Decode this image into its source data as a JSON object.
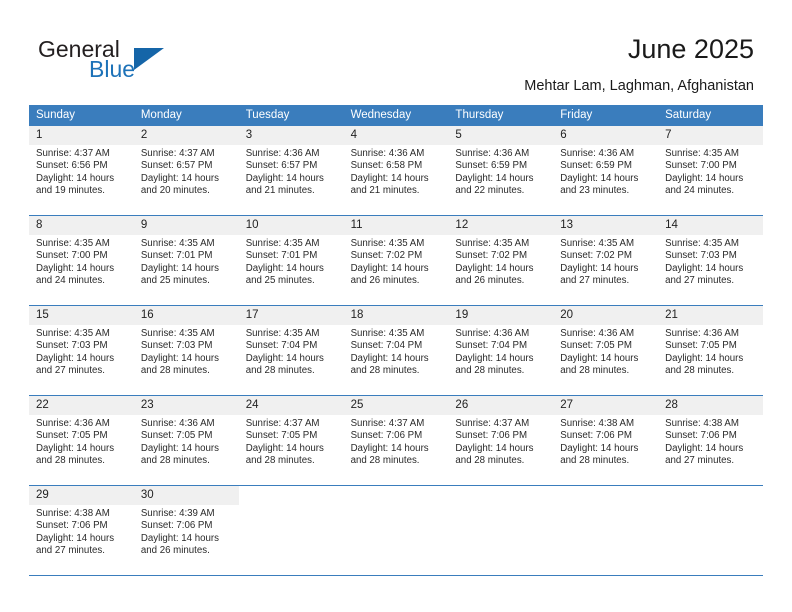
{
  "brand": {
    "name_part1": "General",
    "name_part2": "Blue",
    "accent_color": "#1d72b8"
  },
  "header": {
    "title": "June 2025",
    "subtitle": "Mehtar Lam, Laghman, Afghanistan"
  },
  "calendar": {
    "header_color": "#3a7dbd",
    "weekdays": [
      "Sunday",
      "Monday",
      "Tuesday",
      "Wednesday",
      "Thursday",
      "Friday",
      "Saturday"
    ],
    "weeks": [
      [
        {
          "day": "1",
          "sunrise": "Sunrise: 4:37 AM",
          "sunset": "Sunset: 6:56 PM",
          "daylight1": "Daylight: 14 hours",
          "daylight2": "and 19 minutes."
        },
        {
          "day": "2",
          "sunrise": "Sunrise: 4:37 AM",
          "sunset": "Sunset: 6:57 PM",
          "daylight1": "Daylight: 14 hours",
          "daylight2": "and 20 minutes."
        },
        {
          "day": "3",
          "sunrise": "Sunrise: 4:36 AM",
          "sunset": "Sunset: 6:57 PM",
          "daylight1": "Daylight: 14 hours",
          "daylight2": "and 21 minutes."
        },
        {
          "day": "4",
          "sunrise": "Sunrise: 4:36 AM",
          "sunset": "Sunset: 6:58 PM",
          "daylight1": "Daylight: 14 hours",
          "daylight2": "and 21 minutes."
        },
        {
          "day": "5",
          "sunrise": "Sunrise: 4:36 AM",
          "sunset": "Sunset: 6:59 PM",
          "daylight1": "Daylight: 14 hours",
          "daylight2": "and 22 minutes."
        },
        {
          "day": "6",
          "sunrise": "Sunrise: 4:36 AM",
          "sunset": "Sunset: 6:59 PM",
          "daylight1": "Daylight: 14 hours",
          "daylight2": "and 23 minutes."
        },
        {
          "day": "7",
          "sunrise": "Sunrise: 4:35 AM",
          "sunset": "Sunset: 7:00 PM",
          "daylight1": "Daylight: 14 hours",
          "daylight2": "and 24 minutes."
        }
      ],
      [
        {
          "day": "8",
          "sunrise": "Sunrise: 4:35 AM",
          "sunset": "Sunset: 7:00 PM",
          "daylight1": "Daylight: 14 hours",
          "daylight2": "and 24 minutes."
        },
        {
          "day": "9",
          "sunrise": "Sunrise: 4:35 AM",
          "sunset": "Sunset: 7:01 PM",
          "daylight1": "Daylight: 14 hours",
          "daylight2": "and 25 minutes."
        },
        {
          "day": "10",
          "sunrise": "Sunrise: 4:35 AM",
          "sunset": "Sunset: 7:01 PM",
          "daylight1": "Daylight: 14 hours",
          "daylight2": "and 25 minutes."
        },
        {
          "day": "11",
          "sunrise": "Sunrise: 4:35 AM",
          "sunset": "Sunset: 7:02 PM",
          "daylight1": "Daylight: 14 hours",
          "daylight2": "and 26 minutes."
        },
        {
          "day": "12",
          "sunrise": "Sunrise: 4:35 AM",
          "sunset": "Sunset: 7:02 PM",
          "daylight1": "Daylight: 14 hours",
          "daylight2": "and 26 minutes."
        },
        {
          "day": "13",
          "sunrise": "Sunrise: 4:35 AM",
          "sunset": "Sunset: 7:02 PM",
          "daylight1": "Daylight: 14 hours",
          "daylight2": "and 27 minutes."
        },
        {
          "day": "14",
          "sunrise": "Sunrise: 4:35 AM",
          "sunset": "Sunset: 7:03 PM",
          "daylight1": "Daylight: 14 hours",
          "daylight2": "and 27 minutes."
        }
      ],
      [
        {
          "day": "15",
          "sunrise": "Sunrise: 4:35 AM",
          "sunset": "Sunset: 7:03 PM",
          "daylight1": "Daylight: 14 hours",
          "daylight2": "and 27 minutes."
        },
        {
          "day": "16",
          "sunrise": "Sunrise: 4:35 AM",
          "sunset": "Sunset: 7:03 PM",
          "daylight1": "Daylight: 14 hours",
          "daylight2": "and 28 minutes."
        },
        {
          "day": "17",
          "sunrise": "Sunrise: 4:35 AM",
          "sunset": "Sunset: 7:04 PM",
          "daylight1": "Daylight: 14 hours",
          "daylight2": "and 28 minutes."
        },
        {
          "day": "18",
          "sunrise": "Sunrise: 4:35 AM",
          "sunset": "Sunset: 7:04 PM",
          "daylight1": "Daylight: 14 hours",
          "daylight2": "and 28 minutes."
        },
        {
          "day": "19",
          "sunrise": "Sunrise: 4:36 AM",
          "sunset": "Sunset: 7:04 PM",
          "daylight1": "Daylight: 14 hours",
          "daylight2": "and 28 minutes."
        },
        {
          "day": "20",
          "sunrise": "Sunrise: 4:36 AM",
          "sunset": "Sunset: 7:05 PM",
          "daylight1": "Daylight: 14 hours",
          "daylight2": "and 28 minutes."
        },
        {
          "day": "21",
          "sunrise": "Sunrise: 4:36 AM",
          "sunset": "Sunset: 7:05 PM",
          "daylight1": "Daylight: 14 hours",
          "daylight2": "and 28 minutes."
        }
      ],
      [
        {
          "day": "22",
          "sunrise": "Sunrise: 4:36 AM",
          "sunset": "Sunset: 7:05 PM",
          "daylight1": "Daylight: 14 hours",
          "daylight2": "and 28 minutes."
        },
        {
          "day": "23",
          "sunrise": "Sunrise: 4:36 AM",
          "sunset": "Sunset: 7:05 PM",
          "daylight1": "Daylight: 14 hours",
          "daylight2": "and 28 minutes."
        },
        {
          "day": "24",
          "sunrise": "Sunrise: 4:37 AM",
          "sunset": "Sunset: 7:05 PM",
          "daylight1": "Daylight: 14 hours",
          "daylight2": "and 28 minutes."
        },
        {
          "day": "25",
          "sunrise": "Sunrise: 4:37 AM",
          "sunset": "Sunset: 7:06 PM",
          "daylight1": "Daylight: 14 hours",
          "daylight2": "and 28 minutes."
        },
        {
          "day": "26",
          "sunrise": "Sunrise: 4:37 AM",
          "sunset": "Sunset: 7:06 PM",
          "daylight1": "Daylight: 14 hours",
          "daylight2": "and 28 minutes."
        },
        {
          "day": "27",
          "sunrise": "Sunrise: 4:38 AM",
          "sunset": "Sunset: 7:06 PM",
          "daylight1": "Daylight: 14 hours",
          "daylight2": "and 28 minutes."
        },
        {
          "day": "28",
          "sunrise": "Sunrise: 4:38 AM",
          "sunset": "Sunset: 7:06 PM",
          "daylight1": "Daylight: 14 hours",
          "daylight2": "and 27 minutes."
        }
      ],
      [
        {
          "day": "29",
          "sunrise": "Sunrise: 4:38 AM",
          "sunset": "Sunset: 7:06 PM",
          "daylight1": "Daylight: 14 hours",
          "daylight2": "and 27 minutes."
        },
        {
          "day": "30",
          "sunrise": "Sunrise: 4:39 AM",
          "sunset": "Sunset: 7:06 PM",
          "daylight1": "Daylight: 14 hours",
          "daylight2": "and 26 minutes."
        },
        {
          "day": "",
          "sunrise": "",
          "sunset": "",
          "daylight1": "",
          "daylight2": ""
        },
        {
          "day": "",
          "sunrise": "",
          "sunset": "",
          "daylight1": "",
          "daylight2": ""
        },
        {
          "day": "",
          "sunrise": "",
          "sunset": "",
          "daylight1": "",
          "daylight2": ""
        },
        {
          "day": "",
          "sunrise": "",
          "sunset": "",
          "daylight1": "",
          "daylight2": ""
        },
        {
          "day": "",
          "sunrise": "",
          "sunset": "",
          "daylight1": "",
          "daylight2": ""
        }
      ]
    ]
  }
}
